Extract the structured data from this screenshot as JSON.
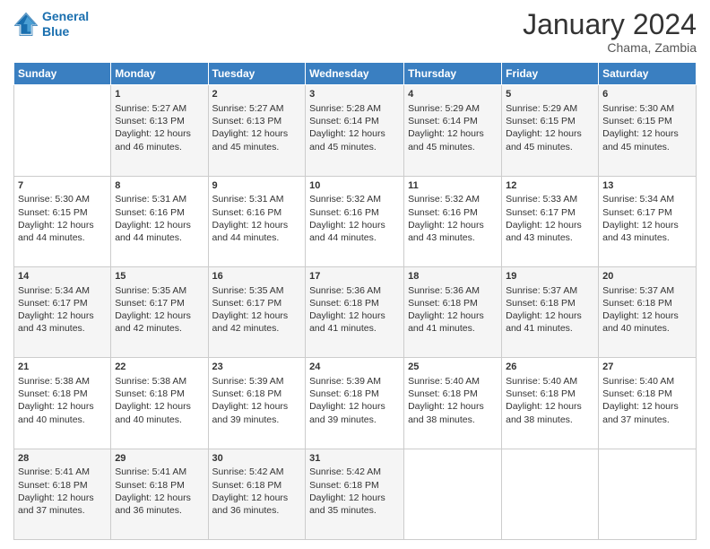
{
  "logo": {
    "line1": "General",
    "line2": "Blue"
  },
  "title": "January 2024",
  "subtitle": "Chama, Zambia",
  "headers": [
    "Sunday",
    "Monday",
    "Tuesday",
    "Wednesday",
    "Thursday",
    "Friday",
    "Saturday"
  ],
  "weeks": [
    [
      {
        "day": "",
        "lines": []
      },
      {
        "day": "1",
        "lines": [
          "Sunrise: 5:27 AM",
          "Sunset: 6:13 PM",
          "Daylight: 12 hours",
          "and 46 minutes."
        ]
      },
      {
        "day": "2",
        "lines": [
          "Sunrise: 5:27 AM",
          "Sunset: 6:13 PM",
          "Daylight: 12 hours",
          "and 45 minutes."
        ]
      },
      {
        "day": "3",
        "lines": [
          "Sunrise: 5:28 AM",
          "Sunset: 6:14 PM",
          "Daylight: 12 hours",
          "and 45 minutes."
        ]
      },
      {
        "day": "4",
        "lines": [
          "Sunrise: 5:29 AM",
          "Sunset: 6:14 PM",
          "Daylight: 12 hours",
          "and 45 minutes."
        ]
      },
      {
        "day": "5",
        "lines": [
          "Sunrise: 5:29 AM",
          "Sunset: 6:15 PM",
          "Daylight: 12 hours",
          "and 45 minutes."
        ]
      },
      {
        "day": "6",
        "lines": [
          "Sunrise: 5:30 AM",
          "Sunset: 6:15 PM",
          "Daylight: 12 hours",
          "and 45 minutes."
        ]
      }
    ],
    [
      {
        "day": "7",
        "lines": [
          "Sunrise: 5:30 AM",
          "Sunset: 6:15 PM",
          "Daylight: 12 hours",
          "and 44 minutes."
        ]
      },
      {
        "day": "8",
        "lines": [
          "Sunrise: 5:31 AM",
          "Sunset: 6:16 PM",
          "Daylight: 12 hours",
          "and 44 minutes."
        ]
      },
      {
        "day": "9",
        "lines": [
          "Sunrise: 5:31 AM",
          "Sunset: 6:16 PM",
          "Daylight: 12 hours",
          "and 44 minutes."
        ]
      },
      {
        "day": "10",
        "lines": [
          "Sunrise: 5:32 AM",
          "Sunset: 6:16 PM",
          "Daylight: 12 hours",
          "and 44 minutes."
        ]
      },
      {
        "day": "11",
        "lines": [
          "Sunrise: 5:32 AM",
          "Sunset: 6:16 PM",
          "Daylight: 12 hours",
          "and 43 minutes."
        ]
      },
      {
        "day": "12",
        "lines": [
          "Sunrise: 5:33 AM",
          "Sunset: 6:17 PM",
          "Daylight: 12 hours",
          "and 43 minutes."
        ]
      },
      {
        "day": "13",
        "lines": [
          "Sunrise: 5:34 AM",
          "Sunset: 6:17 PM",
          "Daylight: 12 hours",
          "and 43 minutes."
        ]
      }
    ],
    [
      {
        "day": "14",
        "lines": [
          "Sunrise: 5:34 AM",
          "Sunset: 6:17 PM",
          "Daylight: 12 hours",
          "and 43 minutes."
        ]
      },
      {
        "day": "15",
        "lines": [
          "Sunrise: 5:35 AM",
          "Sunset: 6:17 PM",
          "Daylight: 12 hours",
          "and 42 minutes."
        ]
      },
      {
        "day": "16",
        "lines": [
          "Sunrise: 5:35 AM",
          "Sunset: 6:17 PM",
          "Daylight: 12 hours",
          "and 42 minutes."
        ]
      },
      {
        "day": "17",
        "lines": [
          "Sunrise: 5:36 AM",
          "Sunset: 6:18 PM",
          "Daylight: 12 hours",
          "and 41 minutes."
        ]
      },
      {
        "day": "18",
        "lines": [
          "Sunrise: 5:36 AM",
          "Sunset: 6:18 PM",
          "Daylight: 12 hours",
          "and 41 minutes."
        ]
      },
      {
        "day": "19",
        "lines": [
          "Sunrise: 5:37 AM",
          "Sunset: 6:18 PM",
          "Daylight: 12 hours",
          "and 41 minutes."
        ]
      },
      {
        "day": "20",
        "lines": [
          "Sunrise: 5:37 AM",
          "Sunset: 6:18 PM",
          "Daylight: 12 hours",
          "and 40 minutes."
        ]
      }
    ],
    [
      {
        "day": "21",
        "lines": [
          "Sunrise: 5:38 AM",
          "Sunset: 6:18 PM",
          "Daylight: 12 hours",
          "and 40 minutes."
        ]
      },
      {
        "day": "22",
        "lines": [
          "Sunrise: 5:38 AM",
          "Sunset: 6:18 PM",
          "Daylight: 12 hours",
          "and 40 minutes."
        ]
      },
      {
        "day": "23",
        "lines": [
          "Sunrise: 5:39 AM",
          "Sunset: 6:18 PM",
          "Daylight: 12 hours",
          "and 39 minutes."
        ]
      },
      {
        "day": "24",
        "lines": [
          "Sunrise: 5:39 AM",
          "Sunset: 6:18 PM",
          "Daylight: 12 hours",
          "and 39 minutes."
        ]
      },
      {
        "day": "25",
        "lines": [
          "Sunrise: 5:40 AM",
          "Sunset: 6:18 PM",
          "Daylight: 12 hours",
          "and 38 minutes."
        ]
      },
      {
        "day": "26",
        "lines": [
          "Sunrise: 5:40 AM",
          "Sunset: 6:18 PM",
          "Daylight: 12 hours",
          "and 38 minutes."
        ]
      },
      {
        "day": "27",
        "lines": [
          "Sunrise: 5:40 AM",
          "Sunset: 6:18 PM",
          "Daylight: 12 hours",
          "and 37 minutes."
        ]
      }
    ],
    [
      {
        "day": "28",
        "lines": [
          "Sunrise: 5:41 AM",
          "Sunset: 6:18 PM",
          "Daylight: 12 hours",
          "and 37 minutes."
        ]
      },
      {
        "day": "29",
        "lines": [
          "Sunrise: 5:41 AM",
          "Sunset: 6:18 PM",
          "Daylight: 12 hours",
          "and 36 minutes."
        ]
      },
      {
        "day": "30",
        "lines": [
          "Sunrise: 5:42 AM",
          "Sunset: 6:18 PM",
          "Daylight: 12 hours",
          "and 36 minutes."
        ]
      },
      {
        "day": "31",
        "lines": [
          "Sunrise: 5:42 AM",
          "Sunset: 6:18 PM",
          "Daylight: 12 hours",
          "and 35 minutes."
        ]
      },
      {
        "day": "",
        "lines": []
      },
      {
        "day": "",
        "lines": []
      },
      {
        "day": "",
        "lines": []
      }
    ]
  ]
}
